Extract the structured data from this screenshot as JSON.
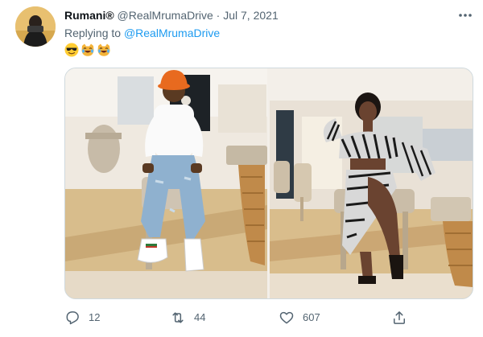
{
  "tweet": {
    "display_name": "Rumani®",
    "handle": "@RealMrumaDrive",
    "separator": "·",
    "timestamp": "Jul 7, 2021",
    "replying_prefix": "Replying to",
    "replying_to": "@RealMrumaDrive",
    "emojis": [
      "smiling-face-with-sunglasses",
      "rolling-on-floor-laughing-cat",
      "rolling-on-floor-laughing-cat"
    ]
  },
  "actions": {
    "reply": {
      "icon": "reply-icon",
      "count": "12"
    },
    "retweet": {
      "icon": "retweet-icon",
      "count": "44"
    },
    "like": {
      "icon": "heart-icon",
      "count": "607"
    },
    "share": {
      "icon": "share-icon",
      "count": ""
    }
  },
  "colors": {
    "link": "#1d9bf0",
    "secondary_text": "#536471",
    "primary_text": "#0f1419",
    "border": "#cfd9de"
  }
}
